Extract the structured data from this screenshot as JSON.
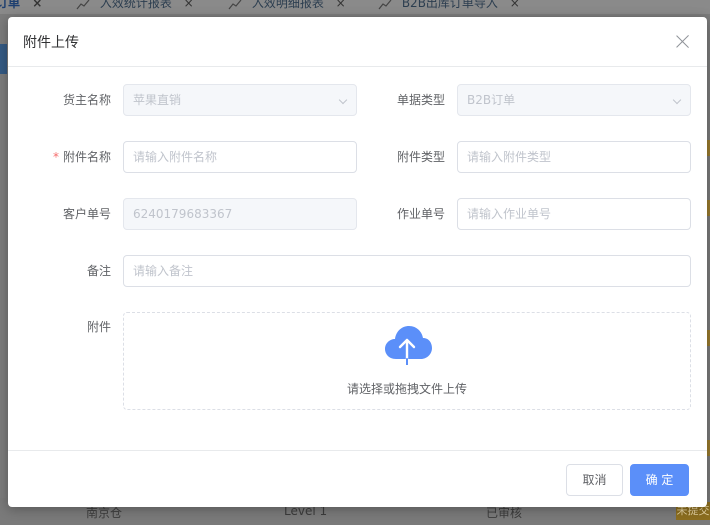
{
  "background": {
    "tabs": [
      {
        "label": "订单",
        "close": "×"
      },
      {
        "label": "入效统计报表",
        "close": "×"
      },
      {
        "label": "入效明细报表",
        "close": "×"
      },
      {
        "label": "B2B出库订单导入",
        "close": "×"
      }
    ],
    "bottom_row": [
      "南京仓",
      "Level 1",
      "已审核"
    ],
    "bottom_tag": "未提交"
  },
  "dialog": {
    "title": "附件上传",
    "fields": {
      "owner": {
        "label": "货主名称",
        "value": "苹果直销"
      },
      "doc_type": {
        "label": "单据类型",
        "value": "B2B订单"
      },
      "attach_name": {
        "label": "附件名称",
        "required_mark": "*",
        "placeholder": "请输入附件名称"
      },
      "attach_type": {
        "label": "附件类型",
        "placeholder": "请输入附件类型"
      },
      "customer_no": {
        "label": "客户单号",
        "value": "6240179683367"
      },
      "job_no": {
        "label": "作业单号",
        "placeholder": "请输入作业单号"
      },
      "remark": {
        "label": "备注",
        "placeholder": "请输入备注"
      },
      "attachment": {
        "label": "附件",
        "upload_text": "请选择或拖拽文件上传"
      }
    },
    "footer": {
      "cancel_label": "取消",
      "ok_label": "确 定"
    }
  },
  "colors": {
    "primary": "#5b8ff9",
    "required": "#f56c6c",
    "upload_icon": "#5b8ff9"
  },
  "icons": [
    "close-icon",
    "cloud-upload-icon",
    "chevron-down-icon"
  ]
}
